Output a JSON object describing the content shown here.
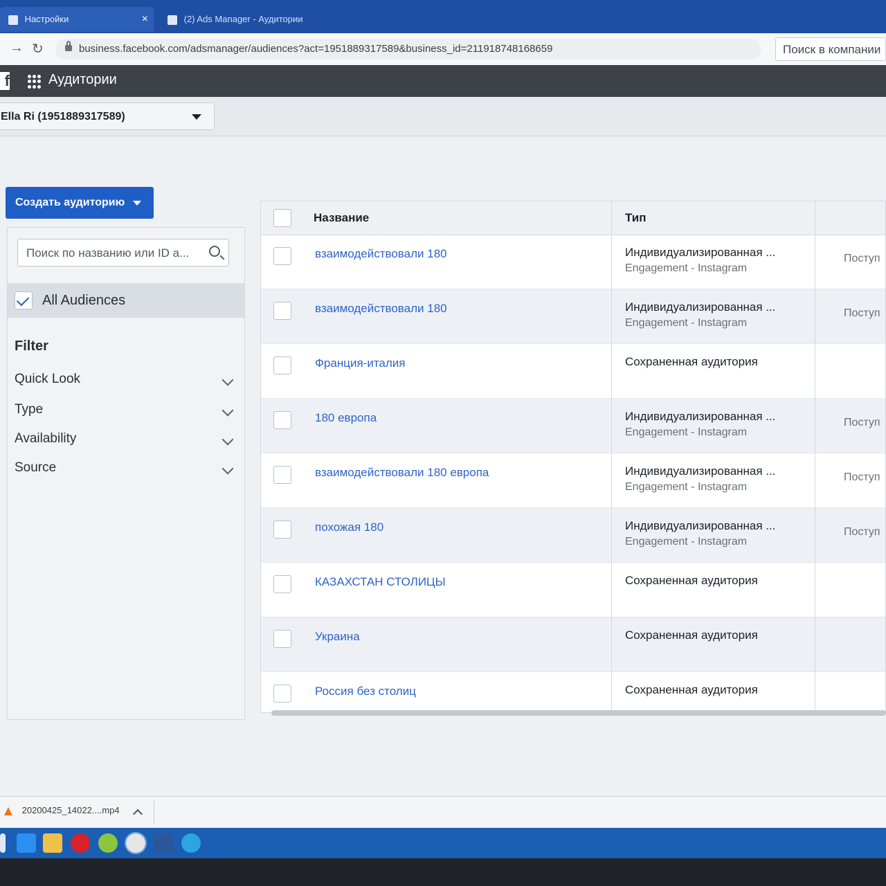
{
  "browser": {
    "tabs": [
      {
        "label": "Настройки"
      },
      {
        "label": "(2) Ads Manager - Аудитории"
      }
    ],
    "url": "business.facebook.com/adsmanager/audiences?act=1951889317589&business_id=211918748168659",
    "business_search_placeholder": "Поиск в компании"
  },
  "app": {
    "title": "Аудитории",
    "account_selector": "Ella Ri (1951889317589)",
    "create_button": "Создать аудиторию"
  },
  "sidebar": {
    "search_placeholder": "Поиск по названию или ID а...",
    "all_audiences": "All Audiences",
    "filter_title": "Filter",
    "filters": [
      "Quick Look",
      "Type",
      "Availability",
      "Source"
    ]
  },
  "table": {
    "columns": [
      "Название",
      "Тип"
    ],
    "rows": [
      {
        "name": "взаимодействовали 180",
        "type": "Индивидуализированная ...",
        "subtype": "Engagement - Instagram",
        "status": "Поступ"
      },
      {
        "name": "взаимодействовали 180",
        "type": "Индивидуализированная ...",
        "subtype": "Engagement - Instagram",
        "status": "Поступ"
      },
      {
        "name": "Франция-италия",
        "type": "Сохраненная аудитория",
        "subtype": "",
        "status": ""
      },
      {
        "name": "180 европа",
        "type": "Индивидуализированная ...",
        "subtype": "Engagement - Instagram",
        "status": "Поступ"
      },
      {
        "name": "взаимодействовали 180 европа",
        "type": "Индивидуализированная ...",
        "subtype": "Engagement - Instagram",
        "status": "Поступ"
      },
      {
        "name": "похожая 180",
        "type": "Индивидуализированная ...",
        "subtype": "Engagement - Instagram",
        "status": "Поступ"
      },
      {
        "name": "КАЗАХСТАН СТОЛИЦЫ",
        "type": "Сохраненная аудитория",
        "subtype": "",
        "status": ""
      },
      {
        "name": "Украина",
        "type": "Сохраненная аудитория",
        "subtype": "",
        "status": ""
      },
      {
        "name": "Россия без столиц",
        "type": "Сохраненная аудитория",
        "subtype": "",
        "status": ""
      }
    ]
  },
  "downloads": {
    "file": "20200425_14022....mp4"
  },
  "colors": {
    "primary": "#1f5ec7",
    "link": "#2e63c7",
    "header": "#3d4148"
  }
}
